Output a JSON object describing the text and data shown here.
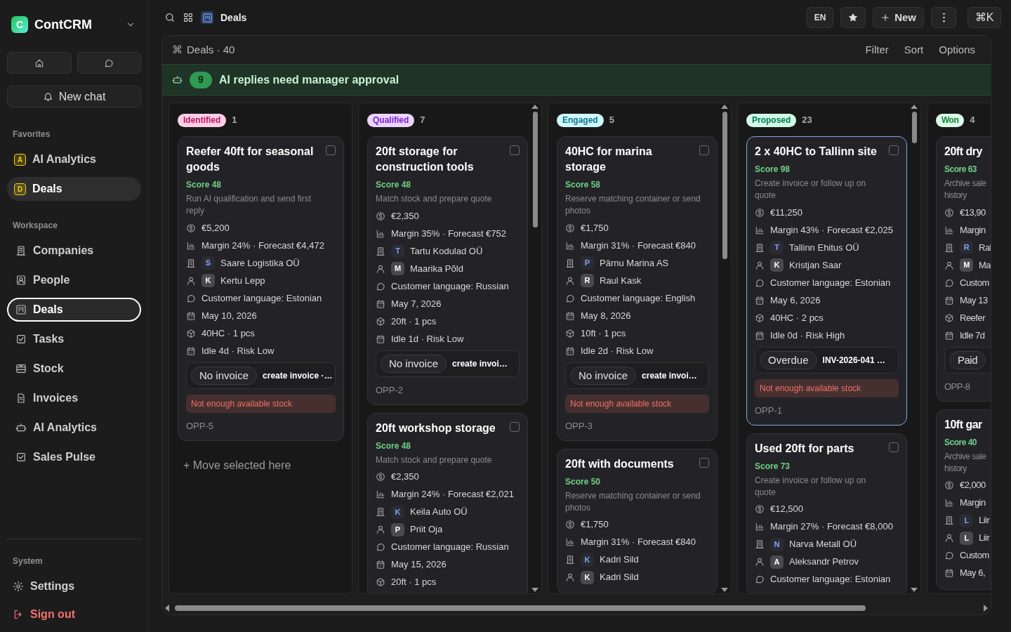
{
  "sidebar": {
    "brand": {
      "logo_letter": "C",
      "name": "ContCRM"
    },
    "new_chat": "New chat",
    "sections": [
      {
        "title": "Favorites",
        "items": [
          {
            "kind": "favorite",
            "badge": "A",
            "color": "#facc15",
            "label": "AI Analytics",
            "selected": false
          },
          {
            "kind": "favorite",
            "badge": "D",
            "color": "#facc15",
            "label": "Deals",
            "selected": true
          }
        ]
      },
      {
        "title": "Workspace",
        "items": [
          {
            "kind": "nav",
            "label": "Companies",
            "selected": false
          },
          {
            "kind": "nav",
            "label": "People",
            "selected": false
          },
          {
            "kind": "nav",
            "label": "Deals",
            "selected": true
          },
          {
            "kind": "nav",
            "label": "Tasks",
            "selected": false
          },
          {
            "kind": "nav",
            "label": "Stock",
            "selected": false
          },
          {
            "kind": "nav",
            "label": "Invoices",
            "selected": false
          },
          {
            "kind": "nav",
            "label": "AI Analytics",
            "selected": false
          },
          {
            "kind": "nav",
            "label": "Sales Pulse",
            "selected": false
          }
        ]
      }
    ],
    "system": {
      "title": "System",
      "items": [
        {
          "kind": "nav",
          "label": "Settings"
        },
        {
          "kind": "danger",
          "label": "Sign out"
        }
      ]
    }
  },
  "topbar": {
    "title": "Deals",
    "lang": "EN",
    "new_label": "New",
    "shortcut": "⌘K"
  },
  "panel": {
    "glyph": "⌘",
    "title": "Deals · 40",
    "actions": [
      "Filter",
      "Sort",
      "Options"
    ]
  },
  "banner": {
    "count": "9",
    "text": "AI replies need manager approval"
  },
  "columns": [
    {
      "label": "Identified",
      "color": "#fbcfe8",
      "count": "1",
      "scrollbar": false,
      "drop_hint": "+ Move selected here",
      "cards": [
        {
          "title": "Reefer 40ft for seasonal goods",
          "score": "Score 48",
          "desc_lines": [
            "Run AI qualification and send first",
            "reply"
          ],
          "amount": "€5,200",
          "margin": "Margin 24% · Forecast €4,472",
          "company": {
            "initial": "S",
            "name": "Saare Logistika OÜ"
          },
          "contact": {
            "initial": "K",
            "name": "Kertu Lepp"
          },
          "language": "Customer language: Estonian",
          "date": "May 10, 2026",
          "units": "40HC · 1 pcs",
          "idle": "Idle 4d · Risk Low",
          "invoice": {
            "status": "No invoice",
            "note": "create invoice ·…"
          },
          "alert": "Not enough available stock",
          "id": "OPP-5",
          "checked": false,
          "selected": false
        }
      ]
    },
    {
      "label": "Qualified",
      "color": "#e9d5ff",
      "count": "7",
      "scrollbar": true,
      "cards": [
        {
          "title": "20ft storage for construction tools",
          "score": "Score 48",
          "desc_lines": [
            "Match stock and prepare quote"
          ],
          "amount": "€2,350",
          "margin": "Margin 35% · Forecast €752",
          "company": {
            "initial": "T",
            "name": "Tartu Kodulad OÜ"
          },
          "contact": {
            "initial": "M",
            "name": "Maarika Põld"
          },
          "language": "Customer language: Russian",
          "date": "May 7, 2026",
          "units": "20ft · 1 pcs",
          "idle": "Idle 1d · Risk Low",
          "invoice": {
            "status": "No invoice",
            "note": "create invoi…"
          },
          "id": "OPP-2",
          "checked": false,
          "selected": false
        },
        {
          "title": "20ft workshop storage",
          "score": "Score 48",
          "desc_lines": [
            "Match stock and prepare quote"
          ],
          "amount": "€2,350",
          "margin": "Margin 24% · Forecast €2,021",
          "company": {
            "initial": "K",
            "name": "Keila Auto OÜ"
          },
          "contact": {
            "initial": "P",
            "name": "Priit Oja"
          },
          "language": "Customer language: Russian",
          "date": "May 15, 2026",
          "units": "20ft · 1 pcs",
          "checked": false,
          "selected": false
        }
      ]
    },
    {
      "label": "Engaged",
      "color": "#cffafe",
      "count": "5",
      "scrollbar": true,
      "cards": [
        {
          "title": "40HC for marina storage",
          "score": "Score 58",
          "desc_lines": [
            "Reserve matching container or send",
            "photos"
          ],
          "amount": "€1,750",
          "margin": "Margin 31% · Forecast €840",
          "company": {
            "initial": "P",
            "name": "Pärnu Marina AS"
          },
          "contact": {
            "initial": "R",
            "name": "Raul Kask"
          },
          "language": "Customer language: English",
          "date": "May 8, 2026",
          "units": "10ft · 1 pcs",
          "idle": "Idle 2d · Risk Low",
          "invoice": {
            "status": "No invoice",
            "note": "create invoi…"
          },
          "alert": "Not enough available stock",
          "id": "OPP-3",
          "checked": false,
          "selected": false
        },
        {
          "title": "20ft with documents",
          "score": "Score 50",
          "desc_lines": [
            "Reserve matching container or send",
            "photos"
          ],
          "amount": "€1,750",
          "margin": "Margin 31% · Forecast €840",
          "company": {
            "initial": "K",
            "name": "Kadri Sild"
          },
          "contact": {
            "initial": "K",
            "name": "Kadri Sild"
          },
          "checked": false,
          "selected": false
        }
      ]
    },
    {
      "label": "Proposed",
      "color": "#d1fae5",
      "count": "23",
      "scrollbar": true,
      "cards": [
        {
          "title": "2 x 40HC to Tallinn site",
          "score": "Score 98",
          "desc_lines": [
            "Create invoice or follow up on",
            "quote"
          ],
          "amount": "€11,250",
          "margin": "Margin 43% · Forecast €2,025",
          "company": {
            "initial": "T",
            "name": "Tallinn Ehitus OÜ"
          },
          "contact": {
            "initial": "K",
            "name": "Kristjan Saar"
          },
          "language": "Customer language: Estonian",
          "date": "May 6, 2026",
          "units": "40HC · 2 pcs",
          "idle": "Idle 0d · Risk High",
          "invoice": {
            "status": "Overdue",
            "note": "INV-2026-041 …"
          },
          "alert": "Not enough available stock",
          "id": "OPP-1",
          "checked": false,
          "selected": true
        },
        {
          "title": "Used 20ft for parts",
          "score": "Score 73",
          "desc_lines": [
            "Create invoice or follow up on",
            "quote"
          ],
          "amount": "€12,500",
          "margin": "Margin 27% · Forecast €8,000",
          "company": {
            "initial": "N",
            "name": "Narva Metall OÜ"
          },
          "contact": {
            "initial": "A",
            "name": "Aleksandr Petrov"
          },
          "language": "Customer language: Estonian",
          "checked": false,
          "selected": false
        }
      ]
    },
    {
      "label": "Won",
      "color": "#dcfce7",
      "count": "4",
      "scrollbar": false,
      "cards": [
        {
          "title": "20ft dry",
          "score": "Score 63",
          "desc_lines": [
            "Archive sale",
            "history"
          ],
          "amount": "€13,90",
          "margin": "Margin",
          "company": {
            "initial": "R",
            "name": "Ral"
          },
          "contact": {
            "initial": "M",
            "name": "Ma"
          },
          "language": "Custom",
          "date": "May 13",
          "units": "Reefer",
          "idle": "Idle 7d",
          "invoice": {
            "status": "Paid"
          },
          "id": "OPP-8",
          "selected": false
        },
        {
          "title": "10ft gar",
          "score": "Score 40",
          "desc_lines": [
            "Archive sale",
            "history"
          ],
          "amount": "€2,000",
          "margin": "Margin",
          "company": {
            "initial": "L",
            "name": "Liir"
          },
          "contact": {
            "initial": "L",
            "name": "Liir"
          },
          "language": "Custom",
          "date": "May 6,",
          "selected": false
        }
      ]
    }
  ]
}
